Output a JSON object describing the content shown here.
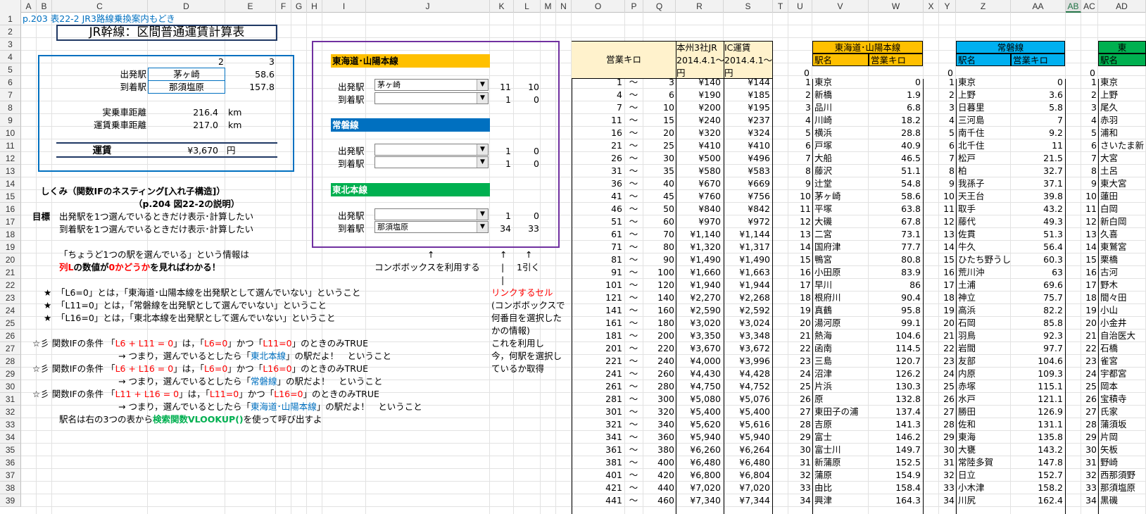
{
  "columns": [
    [
      "A",
      30,
      22
    ],
    [
      "B",
      52,
      22
    ],
    [
      "C",
      74,
      136
    ],
    [
      "D",
      210,
      110
    ],
    [
      "E",
      320,
      72
    ],
    [
      "F",
      392,
      22
    ],
    [
      "G",
      414,
      22
    ],
    [
      "H",
      436,
      22
    ],
    [
      "I",
      458,
      62
    ],
    [
      "J",
      520,
      176
    ],
    [
      "K",
      696,
      34
    ],
    [
      "L",
      730,
      38
    ],
    [
      "M",
      768,
      22
    ],
    [
      "N",
      790,
      22
    ],
    [
      "O",
      812,
      76
    ],
    [
      "P",
      888,
      26
    ],
    [
      "Q",
      914,
      46
    ],
    [
      "R",
      960,
      68
    ],
    [
      "S",
      1028,
      70
    ],
    [
      "T",
      1098,
      22
    ],
    [
      "U",
      1120,
      34
    ],
    [
      "V",
      1154,
      80
    ],
    [
      "W",
      1234,
      78
    ],
    [
      "X",
      1312,
      22
    ],
    [
      "Y",
      1334,
      24
    ],
    [
      "Z",
      1358,
      78
    ],
    [
      "AA",
      1436,
      78
    ],
    [
      "AB",
      1514,
      22
    ],
    [
      "AC",
      1536,
      24
    ],
    [
      "AD",
      1560,
      68
    ]
  ],
  "selected_col": "AB",
  "rows": [
    "1",
    "2",
    "3",
    "4",
    "5",
    "6",
    "7",
    "8",
    "9",
    "10",
    "11",
    "12",
    "13",
    "14",
    "15",
    "16",
    "17",
    "18",
    "19",
    "20",
    "21",
    "22",
    "23",
    "24",
    "25",
    "26",
    "27",
    "28",
    "29",
    "30",
    "31",
    "32",
    "33",
    "34",
    "35",
    "36",
    "37",
    "38",
    "39"
  ],
  "header_line": "p.203 表22-2 JR3路線乗換案内もどき",
  "title": "JR幹線：区間普通運賃計算表",
  "calc": {
    "col2": "2",
    "col3": "3",
    "dep_label": "出発駅",
    "dep_value": "茅ヶ崎",
    "dep_km": "58.6",
    "arr_label": "到着駅",
    "arr_value": "那須塩原",
    "arr_km": "157.8",
    "actual_label": "実乗車距離",
    "actual_value": "216.4",
    "actual_unit": "km",
    "fare_dist_label": "運賃乗車距離",
    "fare_dist_value": "217.0",
    "fare_dist_unit": "km",
    "fare_label": "運賃",
    "fare_value": "¥3,670",
    "fare_unit": "円"
  },
  "combo_panel": {
    "line1": "東海道･山陽本線",
    "line1_color": "#ffc000",
    "line2": "常磐線",
    "line2_color": "#0070c0",
    "line3": "東北本線",
    "line3_color": "#00b050",
    "dep": "出発駅",
    "arr": "到着駅",
    "l1_dep": "茅ヶ崎",
    "l1_dep_k": "11",
    "l1_dep_l": "10",
    "l1_arr": "",
    "l1_arr_k": "1",
    "l1_arr_l": "0",
    "l2_dep": "",
    "l2_dep_k": "1",
    "l2_dep_l": "0",
    "l2_arr": "",
    "l2_arr_k": "1",
    "l2_arr_l": "0",
    "l3_dep": "",
    "l3_dep_k": "1",
    "l3_dep_l": "0",
    "l3_arr": "那須塩原",
    "l3_arr_k": "34",
    "l3_arr_l": "33"
  },
  "notes": {
    "arrow": "↑",
    "arrow2": "↑",
    "arrow3": "↑",
    "combo_use": "コンボボックスを利用する",
    "minus1": "1引く",
    "pipe": "|",
    "pipe2": "|",
    "link_cell": "リンクするセル",
    "link2": "(コンボボックスで",
    "link3": "何番目を選択した",
    "link4": "かの情報)",
    "link5": "これを利用し",
    "link6": "今，何駅を選択し",
    "link7": "ているか取得",
    "mech1": "しくみ（関数IFのネスティング[入れ子構造]）",
    "mech2": "（p.204 図22-2の説明）",
    "goal": "目標",
    "goal1": "出発駅を1つ選んでいるときだけ表示･計算したい",
    "goal2": "到着駅を1つ選んでいるときだけ表示･計算したい",
    "info1": "「ちょうど1つの駅を選んでいる」という情報は",
    "info2a": "列L",
    "info2b": "の数値が",
    "info2c": "0かどうか",
    "info2d": "を見ればわかる！",
    "star": "★",
    "star1": "「L6=0」とは，「東海道･山陽本線を出発駅として選んでいない」ということ",
    "star2": "「L11=0」とは，「常磐線を出発駅として選んでいない」ということ",
    "star3": "「L16=0」とは，「東北本線を出発駅として選んでいない」ということ",
    "cond": "☆彡",
    "cond_lbl": "関数IFの条件",
    "c1a": "「",
    "c1b": "L6 + L11 = 0",
    "c1c": "」は，「",
    "c1d": "L6=0",
    "c1e": "」かつ「",
    "c1f": "L11=0",
    "c1g": "」のときのみTRUE",
    "c1h": "→ つまり，選んでいるとしたら「",
    "c1i": "東北本線",
    "c1j": "」の駅だよ！　ということ",
    "c2b": "L6 + L16 = 0",
    "c2d": "L6=0",
    "c2f": "L16=0",
    "c2i": "常磐線",
    "c3b": "L11 + L16 = 0",
    "c3d": "L11=0",
    "c3f": "L16=0",
    "c3i": "東海道･山陽本線",
    "last1": "駅名は右の3つの表から",
    "last2": "検索関数VLOOKUP()",
    "last3": "を使って呼び出すよ"
  },
  "fare_table": {
    "h_km": "営業キロ",
    "h_r1": "本州3社JR",
    "h_r2": "2014.4.1～",
    "h_r3": "円",
    "h_s1": "IC運賃",
    "h_s2": "2014.4.1～",
    "h_s3": "円",
    "tilde": "～",
    "rows": [
      [
        "1",
        "3",
        "¥140",
        "¥144"
      ],
      [
        "4",
        "6",
        "¥190",
        "¥185"
      ],
      [
        "7",
        "10",
        "¥200",
        "¥195"
      ],
      [
        "11",
        "15",
        "¥240",
        "¥237"
      ],
      [
        "16",
        "20",
        "¥320",
        "¥324"
      ],
      [
        "21",
        "25",
        "¥410",
        "¥410"
      ],
      [
        "26",
        "30",
        "¥500",
        "¥496"
      ],
      [
        "31",
        "35",
        "¥580",
        "¥583"
      ],
      [
        "36",
        "40",
        "¥670",
        "¥669"
      ],
      [
        "41",
        "45",
        "¥760",
        "¥756"
      ],
      [
        "46",
        "50",
        "¥840",
        "¥842"
      ],
      [
        "51",
        "60",
        "¥970",
        "¥972"
      ],
      [
        "61",
        "70",
        "¥1,140",
        "¥1,144"
      ],
      [
        "71",
        "80",
        "¥1,320",
        "¥1,317"
      ],
      [
        "81",
        "90",
        "¥1,490",
        "¥1,490"
      ],
      [
        "91",
        "100",
        "¥1,660",
        "¥1,663"
      ],
      [
        "101",
        "120",
        "¥1,940",
        "¥1,944"
      ],
      [
        "121",
        "140",
        "¥2,270",
        "¥2,268"
      ],
      [
        "141",
        "160",
        "¥2,590",
        "¥2,592"
      ],
      [
        "161",
        "180",
        "¥3,020",
        "¥3,024"
      ],
      [
        "181",
        "200",
        "¥3,350",
        "¥3,348"
      ],
      [
        "201",
        "220",
        "¥3,670",
        "¥3,672"
      ],
      [
        "221",
        "240",
        "¥4,000",
        "¥3,996"
      ],
      [
        "241",
        "260",
        "¥4,430",
        "¥4,428"
      ],
      [
        "261",
        "280",
        "¥4,750",
        "¥4,752"
      ],
      [
        "281",
        "300",
        "¥5,080",
        "¥5,076"
      ],
      [
        "301",
        "320",
        "¥5,400",
        "¥5,400"
      ],
      [
        "321",
        "340",
        "¥5,620",
        "¥5,616"
      ],
      [
        "341",
        "360",
        "¥5,940",
        "¥5,940"
      ],
      [
        "361",
        "380",
        "¥6,260",
        "¥6,264"
      ],
      [
        "381",
        "400",
        "¥6,480",
        "¥6,480"
      ],
      [
        "401",
        "420",
        "¥6,800",
        "¥6,804"
      ],
      [
        "421",
        "440",
        "¥7,020",
        "¥7,020"
      ],
      [
        "441",
        "460",
        "¥7,340",
        "¥7,344"
      ]
    ]
  },
  "tokaido": {
    "title": "東海道･山陽本線",
    "h_name": "駅名",
    "h_km": "営業キロ",
    "zero": "0",
    "rows": [
      [
        "1",
        "東京",
        "0"
      ],
      [
        "2",
        "新橋",
        "1.9"
      ],
      [
        "3",
        "品川",
        "6.8"
      ],
      [
        "4",
        "川崎",
        "18.2"
      ],
      [
        "5",
        "横浜",
        "28.8"
      ],
      [
        "6",
        "戸塚",
        "40.9"
      ],
      [
        "7",
        "大船",
        "46.5"
      ],
      [
        "8",
        "藤沢",
        "51.1"
      ],
      [
        "9",
        "辻堂",
        "54.8"
      ],
      [
        "10",
        "茅ヶ崎",
        "58.6"
      ],
      [
        "11",
        "平塚",
        "63.8"
      ],
      [
        "12",
        "大磯",
        "67.8"
      ],
      [
        "13",
        "二宮",
        "73.1"
      ],
      [
        "14",
        "国府津",
        "77.7"
      ],
      [
        "15",
        "鴨宮",
        "80.8"
      ],
      [
        "16",
        "小田原",
        "83.9"
      ],
      [
        "17",
        "早川",
        "86"
      ],
      [
        "18",
        "根府川",
        "90.4"
      ],
      [
        "19",
        "真鶴",
        "95.8"
      ],
      [
        "20",
        "湯河原",
        "99.1"
      ],
      [
        "21",
        "熱海",
        "104.6"
      ],
      [
        "22",
        "函南",
        "114.5"
      ],
      [
        "23",
        "三島",
        "120.7"
      ],
      [
        "24",
        "沼津",
        "126.2"
      ],
      [
        "25",
        "片浜",
        "130.3"
      ],
      [
        "26",
        "原",
        "132.8"
      ],
      [
        "27",
        "東田子の浦",
        "137.4"
      ],
      [
        "28",
        "吉原",
        "141.3"
      ],
      [
        "29",
        "富士",
        "146.2"
      ],
      [
        "30",
        "富士川",
        "149.7"
      ],
      [
        "31",
        "新蒲原",
        "152.5"
      ],
      [
        "32",
        "蒲原",
        "154.9"
      ],
      [
        "33",
        "由比",
        "158.4"
      ],
      [
        "34",
        "興津",
        "164.3"
      ]
    ]
  },
  "joban": {
    "title": "常磐線",
    "h_name": "駅名",
    "h_km": "営業キロ",
    "zero": "0",
    "rows": [
      [
        "1",
        "東京",
        "0"
      ],
      [
        "2",
        "上野",
        "3.6"
      ],
      [
        "3",
        "日暮里",
        "5.8"
      ],
      [
        "4",
        "三河島",
        "7"
      ],
      [
        "5",
        "南千住",
        "9.2"
      ],
      [
        "6",
        "北千住",
        "11"
      ],
      [
        "7",
        "松戸",
        "21.5"
      ],
      [
        "8",
        "柏",
        "32.7"
      ],
      [
        "9",
        "我孫子",
        "37.1"
      ],
      [
        "10",
        "天王台",
        "39.8"
      ],
      [
        "11",
        "取手",
        "43.2"
      ],
      [
        "12",
        "藤代",
        "49.3"
      ],
      [
        "13",
        "佐貫",
        "51.3"
      ],
      [
        "14",
        "牛久",
        "56.4"
      ],
      [
        "15",
        "ひたち野うし",
        "60.3"
      ],
      [
        "16",
        "荒川沖",
        "63"
      ],
      [
        "17",
        "土浦",
        "69.6"
      ],
      [
        "18",
        "神立",
        "75.7"
      ],
      [
        "19",
        "高浜",
        "82.2"
      ],
      [
        "20",
        "石岡",
        "85.8"
      ],
      [
        "21",
        "羽鳥",
        "92.3"
      ],
      [
        "22",
        "岩間",
        "97.7"
      ],
      [
        "23",
        "友部",
        "104.6"
      ],
      [
        "24",
        "内原",
        "109.3"
      ],
      [
        "25",
        "赤塚",
        "115.1"
      ],
      [
        "26",
        "水戸",
        "121.1"
      ],
      [
        "27",
        "勝田",
        "126.9"
      ],
      [
        "28",
        "佐和",
        "131.1"
      ],
      [
        "29",
        "東海",
        "135.8"
      ],
      [
        "30",
        "大甕",
        "143.2"
      ],
      [
        "31",
        "常陸多賀",
        "147.8"
      ],
      [
        "32",
        "日立",
        "152.7"
      ],
      [
        "33",
        "小木津",
        "158.2"
      ],
      [
        "34",
        "川尻",
        "162.4"
      ]
    ]
  },
  "tohoku": {
    "title": "東",
    "h_name": "駅名",
    "zero": "0",
    "rows": [
      [
        "1",
        "東京"
      ],
      [
        "2",
        "上野"
      ],
      [
        "3",
        "尾久"
      ],
      [
        "4",
        "赤羽"
      ],
      [
        "5",
        "浦和"
      ],
      [
        "6",
        "さいたま新"
      ],
      [
        "7",
        "大宮"
      ],
      [
        "8",
        "土呂"
      ],
      [
        "9",
        "東大宮"
      ],
      [
        "10",
        "蓮田"
      ],
      [
        "11",
        "白岡"
      ],
      [
        "12",
        "新白岡"
      ],
      [
        "13",
        "久喜"
      ],
      [
        "14",
        "東鷲宮"
      ],
      [
        "15",
        "栗橋"
      ],
      [
        "16",
        "古河"
      ],
      [
        "17",
        "野木"
      ],
      [
        "18",
        "間々田"
      ],
      [
        "19",
        "小山"
      ],
      [
        "20",
        "小金井"
      ],
      [
        "21",
        "自治医大"
      ],
      [
        "22",
        "石橋"
      ],
      [
        "23",
        "雀宮"
      ],
      [
        "24",
        "宇都宮"
      ],
      [
        "25",
        "岡本"
      ],
      [
        "26",
        "宝積寺"
      ],
      [
        "27",
        "氏家"
      ],
      [
        "28",
        "蒲須坂"
      ],
      [
        "29",
        "片岡"
      ],
      [
        "30",
        "矢板"
      ],
      [
        "31",
        "野崎"
      ],
      [
        "32",
        "西那須野"
      ],
      [
        "33",
        "那須塩原"
      ],
      [
        "34",
        "黒磯"
      ]
    ]
  }
}
